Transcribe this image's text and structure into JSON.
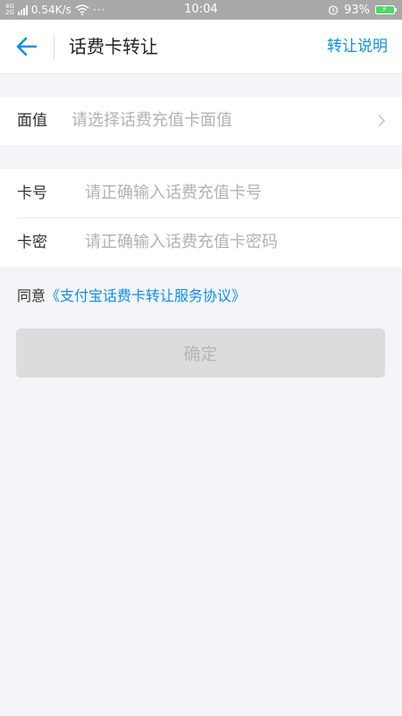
{
  "status_bar": {
    "network_top": "4G",
    "network_bottom": "2G",
    "speed": "0.54K/s",
    "more": "···",
    "time": "10:04",
    "battery": "93%"
  },
  "nav": {
    "title": "话费卡转让",
    "right_link": "转让说明",
    "accent": "#108ee9"
  },
  "denomination": {
    "label": "面值",
    "placeholder": "请选择话费充值卡面值"
  },
  "card_form": {
    "number_label": "卡号",
    "number_placeholder": "请正确输入话费充值卡号",
    "password_label": "卡密",
    "password_placeholder": "请正确输入话费充值卡密码"
  },
  "agreement": {
    "prefix": "同意",
    "link": "《支付宝话费卡转让服务协议》"
  },
  "confirm_button": {
    "label": "确定"
  }
}
